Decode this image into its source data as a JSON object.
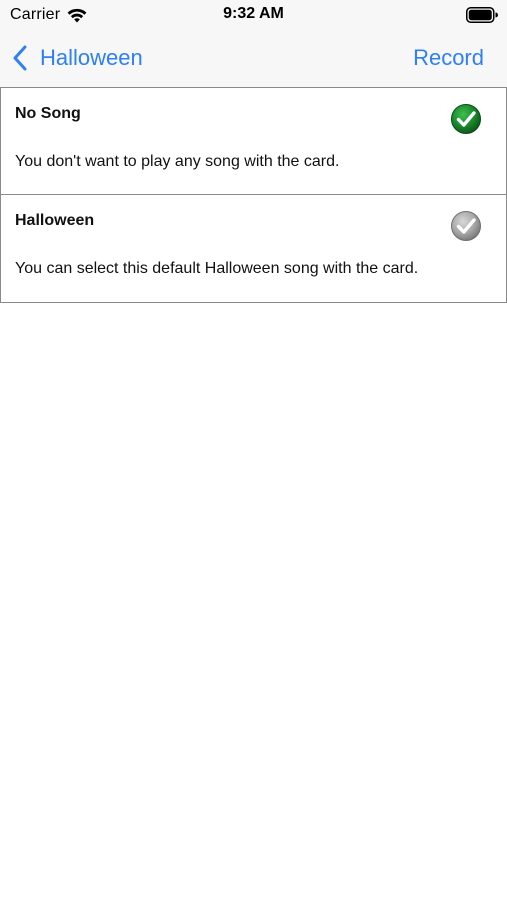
{
  "status_bar": {
    "carrier": "Carrier",
    "time": "9:32 AM",
    "wifi_icon": "wifi-icon",
    "battery_icon": "battery-icon"
  },
  "nav": {
    "back_label": "Halloween",
    "back_icon": "chevron-left-icon",
    "right_action": "Record",
    "accent_color": "#2f7ff6"
  },
  "songs": [
    {
      "title": "No Song",
      "description": "You don't want to play any song with the card.",
      "selected": true,
      "icon": "green-checkmark-icon"
    },
    {
      "title": "Halloween",
      "description": "You can select this default Halloween song with the card.",
      "selected": false,
      "icon": "gray-checkmark-icon"
    }
  ],
  "colors": {
    "selected_check": "#1a8a2e",
    "unselected_check": "#a9a9a9",
    "row_border": "#8a8a8a",
    "bar_background": "#f7f7f7"
  }
}
